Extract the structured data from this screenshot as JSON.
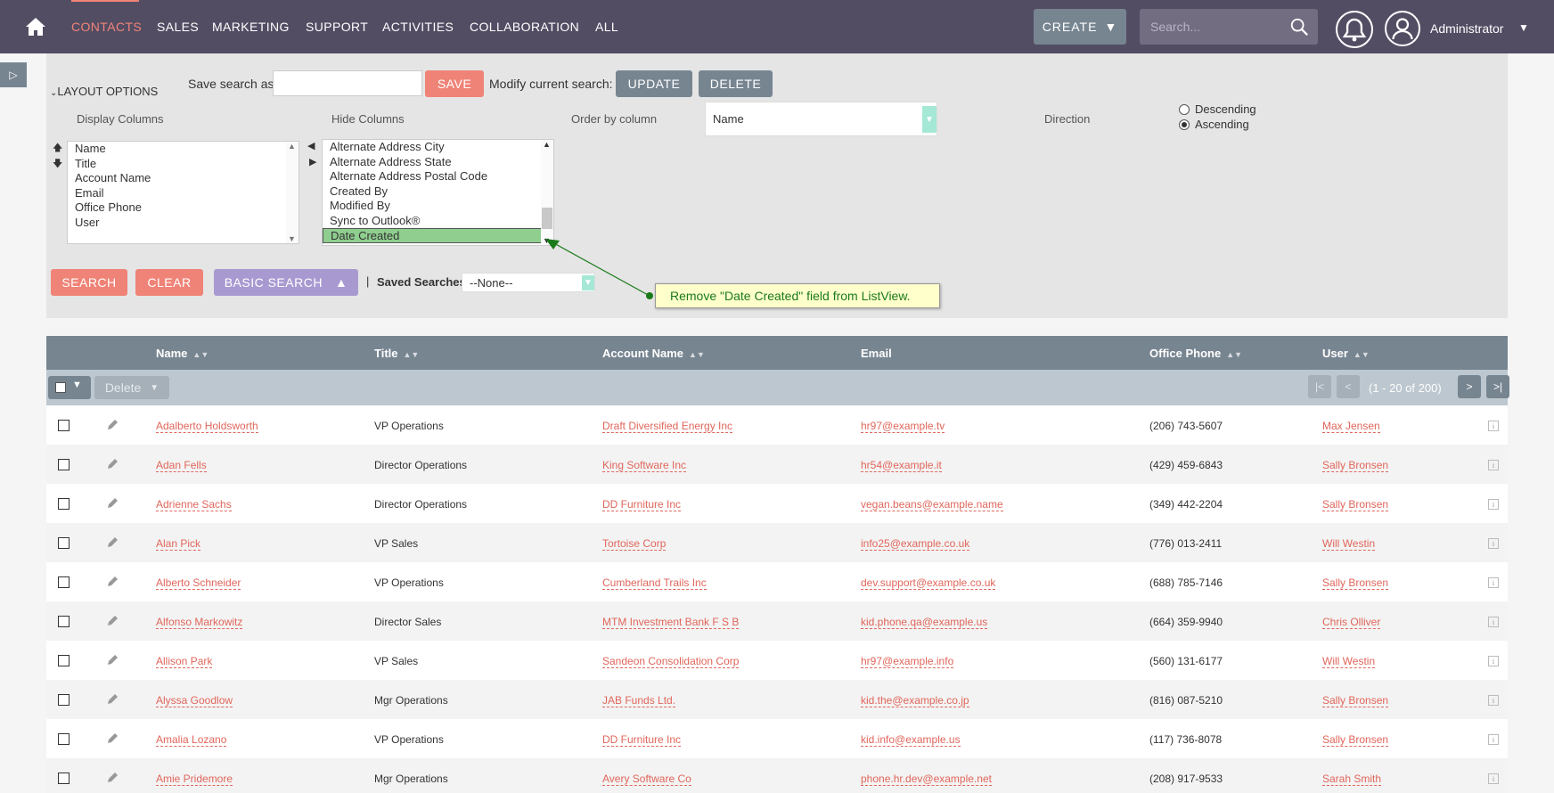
{
  "nav": {
    "items": [
      "CONTACTS",
      "SALES",
      "MARKETING",
      "SUPPORT",
      "ACTIVITIES",
      "COLLABORATION",
      "ALL"
    ],
    "create_label": "CREATE",
    "search_placeholder": "Search...",
    "user_name": "Administrator",
    "accent": "#f08377"
  },
  "search_panel": {
    "layout_options": "LAYOUT OPTIONS",
    "save_search_label": "Save search as:",
    "save_label": "SAVE",
    "modify_label": "Modify current search:",
    "update_label": "UPDATE",
    "delete_label": "DELETE",
    "display_columns_label": "Display Columns",
    "hide_columns_label": "Hide Columns",
    "order_by_label": "Order by column",
    "order_by_value": "Name",
    "direction_label": "Direction",
    "descending_label": "Descending",
    "ascending_label": "Ascending",
    "direction_selected": "Ascending",
    "display_columns": [
      "Name",
      "Title",
      "Account Name",
      "Email",
      "Office Phone",
      "User"
    ],
    "hide_columns": [
      "Alternate Address City",
      "Alternate Address State",
      "Alternate Address Postal Code",
      "Created By",
      "Modified By",
      "Sync to Outlook®",
      "Date Created"
    ],
    "hide_selected": "Date Created",
    "search_label": "SEARCH",
    "clear_label": "CLEAR",
    "basic_search_label": "BASIC SEARCH",
    "saved_searches_label": "Saved Searches",
    "saved_searches_value": "--None--",
    "callout_text": "Remove \"Date Created\" field from ListView."
  },
  "table": {
    "columns": [
      "Name",
      "Title",
      "Account Name",
      "Email",
      "Office Phone",
      "User"
    ],
    "bulk_delete_label": "Delete",
    "pagination_text": "(1 - 20 of 200)",
    "rows": [
      {
        "name": "Adalberto Holdsworth",
        "title": "VP Operations",
        "account": "Draft Diversified Energy Inc",
        "email": "hr97@example.tv",
        "phone": "(206) 743-5607",
        "user": "Max Jensen"
      },
      {
        "name": "Adan Fells",
        "title": "Director Operations",
        "account": "King Software Inc",
        "email": "hr54@example.it",
        "phone": "(429) 459-6843",
        "user": "Sally Bronsen"
      },
      {
        "name": "Adrienne Sachs",
        "title": "Director Operations",
        "account": "DD Furniture Inc",
        "email": "vegan.beans@example.name",
        "phone": "(349) 442-2204",
        "user": "Sally Bronsen"
      },
      {
        "name": "Alan Pick",
        "title": "VP Sales",
        "account": "Tortoise Corp",
        "email": "info25@example.co.uk",
        "phone": "(776) 013-2411",
        "user": "Will Westin"
      },
      {
        "name": "Alberto Schneider",
        "title": "VP Operations",
        "account": "Cumberland Trails Inc",
        "email": "dev.support@example.co.uk",
        "phone": "(688) 785-7146",
        "user": "Sally Bronsen"
      },
      {
        "name": "Alfonso Markowitz",
        "title": "Director Sales",
        "account": "MTM Investment Bank F S B",
        "email": "kid.phone.qa@example.us",
        "phone": "(664) 359-9940",
        "user": "Chris Olliver"
      },
      {
        "name": "Allison Park",
        "title": "VP Sales",
        "account": "Sandeon Consolidation Corp",
        "email": "hr97@example.info",
        "phone": "(560) 131-6177",
        "user": "Will Westin"
      },
      {
        "name": "Alyssa Goodlow",
        "title": "Mgr Operations",
        "account": "JAB Funds Ltd.",
        "email": "kid.the@example.co.jp",
        "phone": "(816) 087-5210",
        "user": "Sally Bronsen"
      },
      {
        "name": "Amalia Lozano",
        "title": "VP Operations",
        "account": "DD Furniture Inc",
        "email": "kid.info@example.us",
        "phone": "(117) 736-8078",
        "user": "Sally Bronsen"
      },
      {
        "name": "Amie Pridemore",
        "title": "Mgr Operations",
        "account": "Avery Software Co",
        "email": "phone.hr.dev@example.net",
        "phone": "(208) 917-9533",
        "user": "Sarah Smith"
      }
    ]
  }
}
